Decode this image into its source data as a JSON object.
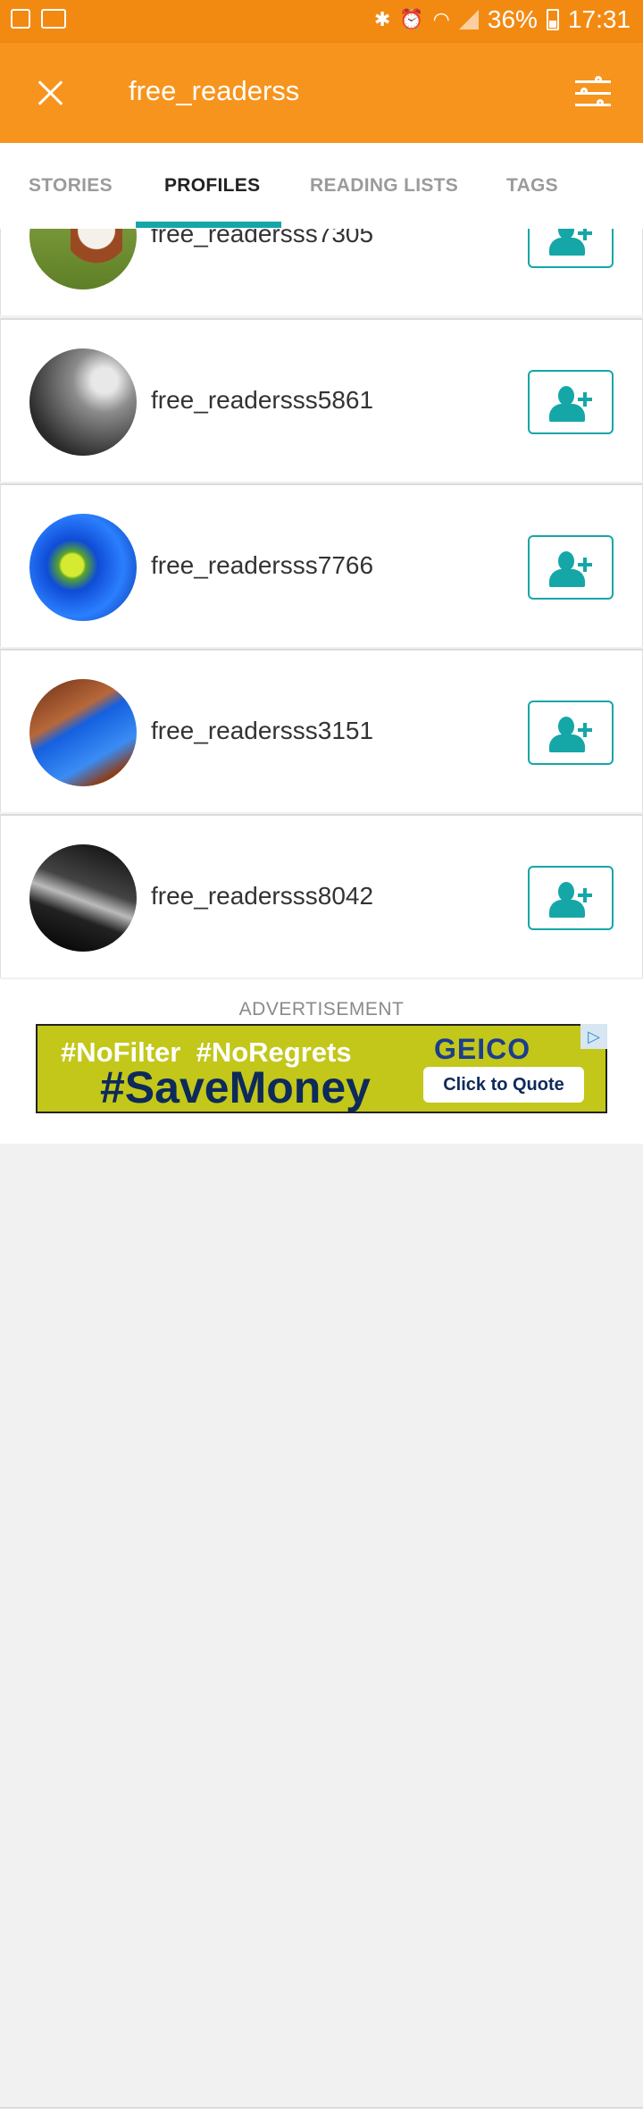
{
  "status_bar": {
    "battery_text": "36%",
    "time": "17:31",
    "icons": [
      "gallery-icon",
      "app-icon",
      "bluetooth-icon",
      "alarm-icon",
      "wifi-icon",
      "signal-icon",
      "battery-charging-icon"
    ]
  },
  "app_bar": {
    "search_query": "free_readerss",
    "close_icon": "close-icon",
    "filter_icon": "filter-sliders-icon",
    "background_color": "#f7941d"
  },
  "tabs": [
    {
      "label": "STORIES",
      "active": false
    },
    {
      "label": "PROFILES",
      "active": true
    },
    {
      "label": "READING LISTS",
      "active": false
    },
    {
      "label": "TAGS",
      "active": false
    }
  ],
  "profiles": [
    {
      "username": "free_readersss7305",
      "avatar": "cow-photo"
    },
    {
      "username": "free_readersss5861",
      "avatar": "street-umbrella-photo"
    },
    {
      "username": "free_readersss7766",
      "avatar": "blue-flower-photo"
    },
    {
      "username": "free_readersss3151",
      "avatar": "rock-arch-photo"
    },
    {
      "username": "free_readersss8042",
      "avatar": "guitar-photo"
    }
  ],
  "follow_icon": "add-person-icon",
  "accent_color": "#15a6a8",
  "ad": {
    "label": "ADVERTISEMENT",
    "line1": "#NoFilter  #NoRegrets",
    "line2": "#SaveMoney",
    "brand": "GEICO",
    "cta": "Click to Quote",
    "choice_icon": "adchoices-icon"
  }
}
